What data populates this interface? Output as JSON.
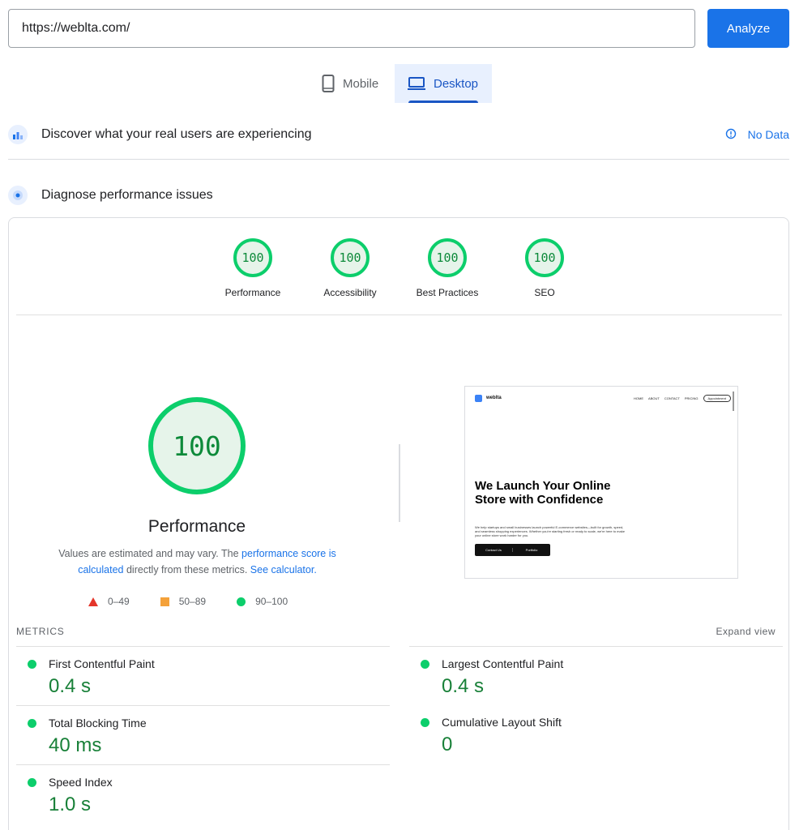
{
  "url_bar": {
    "value": "https://weblta.com/",
    "analyze_label": "Analyze"
  },
  "device_tabs": {
    "mobile": "Mobile",
    "desktop": "Desktop",
    "selected": "Desktop"
  },
  "field_data": {
    "title": "Discover what your real users are experiencing",
    "status": "No Data"
  },
  "lab_data": {
    "title": "Diagnose performance issues"
  },
  "scores": [
    {
      "label": "Performance",
      "value": "100"
    },
    {
      "label": "Accessibility",
      "value": "100"
    },
    {
      "label": "Best Practices",
      "value": "100"
    },
    {
      "label": "SEO",
      "value": "100"
    }
  ],
  "performance": {
    "score": "100",
    "title": "Performance",
    "desc_1": "Values are estimated and may vary. The ",
    "desc_link_1": "performance score is calculated",
    "desc_2": " directly from these metrics. ",
    "desc_link_2": "See calculator.",
    "legend": {
      "fail": "0–49",
      "average": "50–89",
      "pass": "90–100"
    }
  },
  "screenshot": {
    "logo": "weblta",
    "nav_links": [
      "HOME",
      "ABOUT",
      "CONTACT",
      "PRICING"
    ],
    "nav_button": "Appointment",
    "headline": "We Launch Your Online Store with Confidence",
    "paragraph": "We help startups and small businesses launch powerful E-commerce websites—built for growth, speed, and seamless shopping experiences. Whether you're starting fresh or ready to scale, we're here to make your online store work harder for you.",
    "btn_contact": "Contact Us",
    "btn_portfolio": "Portfolio"
  },
  "metrics": {
    "heading": "METRICS",
    "expand": "Expand view",
    "items": [
      {
        "name": "First Contentful Paint",
        "value": "0.4 s"
      },
      {
        "name": "Largest Contentful Paint",
        "value": "0.4 s"
      },
      {
        "name": "Total Blocking Time",
        "value": "40 ms"
      },
      {
        "name": "Cumulative Layout Shift",
        "value": "0"
      },
      {
        "name": "Speed Index",
        "value": "1.0 s"
      }
    ]
  },
  "colors": {
    "accent": "#1a73e8",
    "pass": "#0cce6b",
    "pass_text": "#188038",
    "fail": "#e4352a",
    "average": "#f4a13a"
  }
}
